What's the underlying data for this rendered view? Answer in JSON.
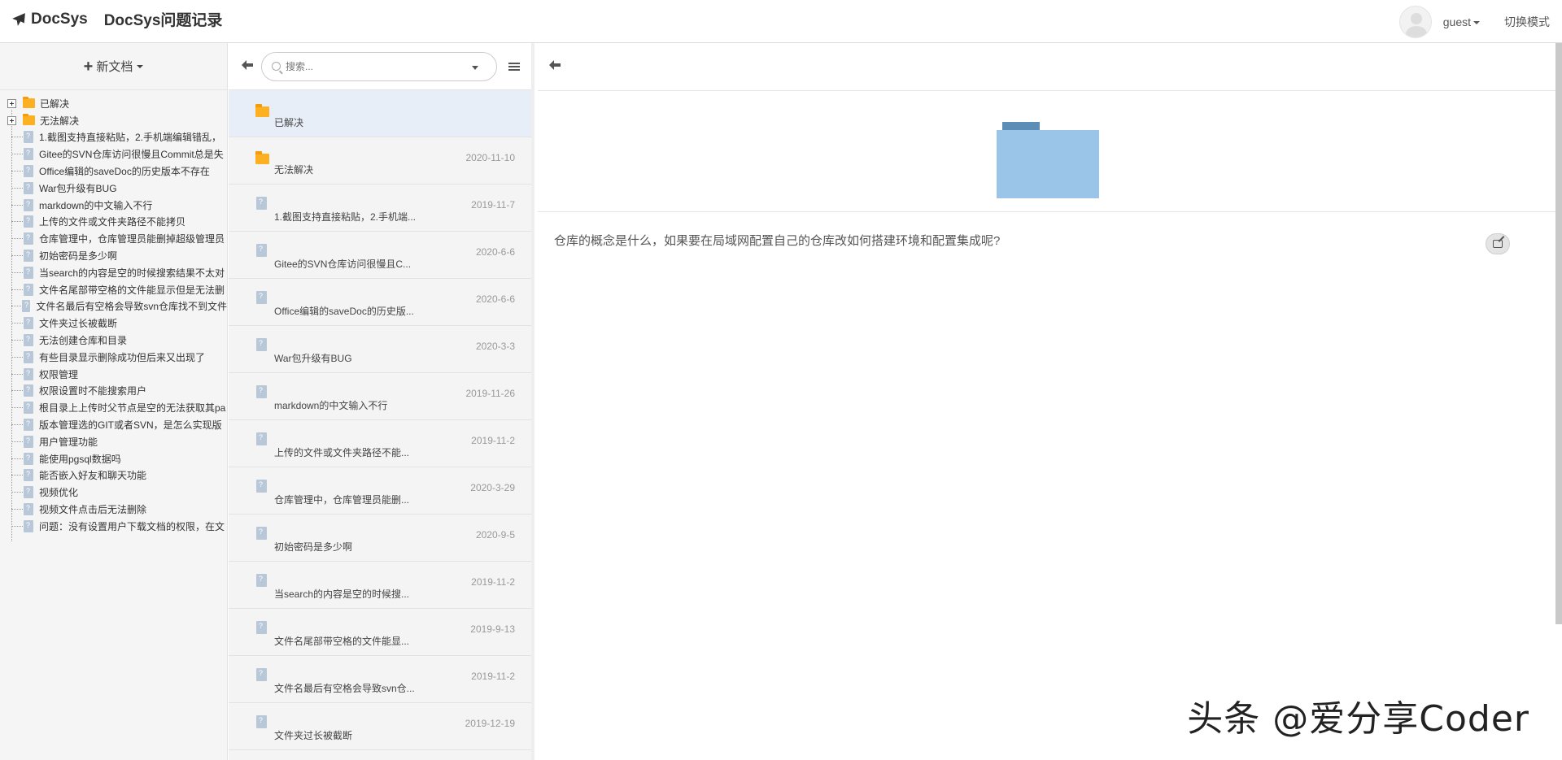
{
  "navbar": {
    "brand": "DocSys",
    "repo_title": "DocSys问题记录",
    "user": "guest",
    "mode_label": "切换模式"
  },
  "tree": {
    "new_doc_label": "新文档",
    "folders": [
      "已解决",
      "无法解决"
    ],
    "docs": [
      "1.截图支持直接粘贴，2.手机端编辑错乱，",
      "Gitee的SVN仓库访问很慢且Commit总是失",
      "Office编辑的saveDoc的历史版本不存在",
      "War包升级有BUG",
      "markdown的中文输入不行",
      "上传的文件或文件夹路径不能拷贝",
      "仓库管理中，仓库管理员能删掉超级管理员",
      "初始密码是多少啊",
      "当search的内容是空的时候搜索结果不太对",
      "文件名尾部带空格的文件能显示但是无法删",
      "文件名最后有空格会导致svn仓库找不到文件",
      "文件夹过长被截断",
      "无法创建仓库和目录",
      "有些目录显示删除成功但后来又出现了",
      "权限管理",
      "权限设置时不能搜索用户",
      "根目录上上传时父节点是空的无法获取其pa",
      "版本管理选的GIT或者SVN，是怎么实现版",
      "用户管理功能",
      "能使用pgsql数据吗",
      "能否嵌入好友和聊天功能",
      "视频优化",
      "视频文件点击后无法删除",
      "问题：没有设置用户下载文档的权限，在文"
    ]
  },
  "list": {
    "search_placeholder": "搜索...",
    "items": [
      {
        "name": "已解决",
        "date": "",
        "type": "folder"
      },
      {
        "name": "无法解决",
        "date": "2020-11-10",
        "type": "folder"
      },
      {
        "name": "1.截图支持直接粘贴，2.手机端...",
        "date": "2019-11-7",
        "type": "doc"
      },
      {
        "name": "Gitee的SVN仓库访问很慢且C...",
        "date": "2020-6-6",
        "type": "doc"
      },
      {
        "name": "Office编辑的saveDoc的历史版...",
        "date": "2020-6-6",
        "type": "doc"
      },
      {
        "name": "War包升级有BUG",
        "date": "2020-3-3",
        "type": "doc"
      },
      {
        "name": "markdown的中文输入不行",
        "date": "2019-11-26",
        "type": "doc"
      },
      {
        "name": "上传的文件或文件夹路径不能...",
        "date": "2019-11-2",
        "type": "doc"
      },
      {
        "name": "仓库管理中，仓库管理员能删...",
        "date": "2020-3-29",
        "type": "doc"
      },
      {
        "name": "初始密码是多少啊",
        "date": "2020-9-5",
        "type": "doc"
      },
      {
        "name": "当search的内容是空的时候搜...",
        "date": "2019-11-2",
        "type": "doc"
      },
      {
        "name": "文件名尾部带空格的文件能显...",
        "date": "2019-9-13",
        "type": "doc"
      },
      {
        "name": "文件名最后有空格会导致svn仓...",
        "date": "2019-11-2",
        "type": "doc"
      },
      {
        "name": "文件夹过长被截断",
        "date": "2019-12-19",
        "type": "doc"
      }
    ]
  },
  "content": {
    "question": "仓库的概念是什么，如果要在局域网配置自己的仓库改如何搭建环境和配置集成呢?"
  },
  "watermark": "头条 @爱分享Coder"
}
